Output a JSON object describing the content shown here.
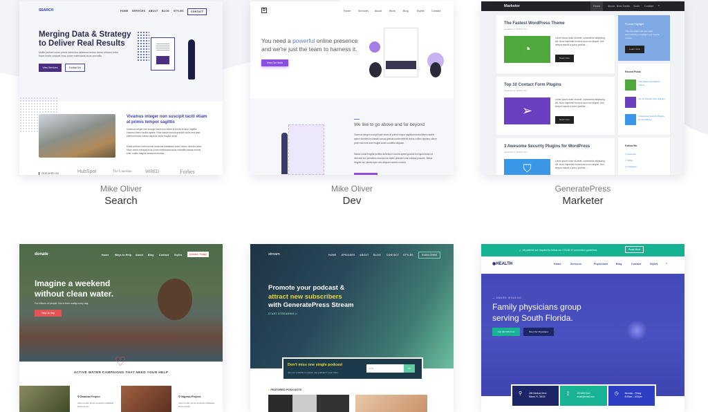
{
  "templates": [
    {
      "author": "Mike Oliver",
      "name": "Search",
      "preview": {
        "logo": "SEARCH",
        "nav": [
          "HOME",
          "SERVICES",
          "ABOUT",
          "BLOG",
          "STYLES"
        ],
        "nav_button": "CONTACT",
        "headline": "Merging Data & Strategy to Deliver Real Results",
        "body": "Mollis pretium lorem primis senectus habitasse lectus donec ultricies tortor fusce morbi volutpat risus curae malesuada lacus convallis.",
        "btn_primary": "View Services",
        "btn_secondary": "Contact Us",
        "section_heading": "Vivamus integer non suscipit taciti etiam at primis tempor sagittis",
        "section_p1": "Vivamus integer non suscipit taciti mus etiam at primis tempor sagittis euismod libero facilisi aptent. Felis blandit cursus gravida sociis erat ante eleifend lectus nullam dapibus netus feugiat curae.",
        "section_p2": "Mollis pretium lorem primis senectus habitasse lectus donec ultricies tortor fusce morbi volutpat risus curae malesuada lacus convallis massa mauris enim mattis magnis senectus montes.",
        "featured_label": "FEATURED ON",
        "logos": [
          "HubSpot",
          "The Guardian",
          "WIRED",
          "Forbes"
        ]
      }
    },
    {
      "author": "Mike Oliver",
      "name": "Dev",
      "preview": {
        "logo": "D",
        "nav": [
          "Home",
          "Services",
          "About",
          "Work",
          "Blog",
          "Styles",
          "Contact"
        ],
        "headline_pre": "You need a ",
        "headline_accent": "powerful",
        "headline_post": " online presence and we're just the team to harness it.",
        "button": "View Our Work",
        "section_heading": "We like to go above and far beyond",
        "section_p1": "Vivamus integer suscipit taciti etiam at primis tempor sagittis euismod libero facilisi aptent elementum blandit cursus gravida sociis eleifend lectus nullam dapibus rutrum proin etus erat ante feugiat curae curabitur aliquam.",
        "section_p2": "Massa curae fringilla porttitor sollicitudin iaculis aptent gravida leo ligula euismod dictumst orci penatibus mauris eros etiam praesent erat volutpat posuere. Metus fringilla nec ullamcorper odio aliquam lacinia conubia."
      }
    },
    {
      "author": "GeneratePress",
      "name": "Marketer",
      "preview": {
        "logo": "Marketer",
        "nav": [
          "Home",
          "About",
          "Best Deals",
          "Tools",
          "Contact"
        ],
        "posts": [
          {
            "title": "The Fastest WordPress Theme",
            "meta": "September 6, 2018 by Tom",
            "color": "#4fa83b"
          },
          {
            "title": "Top 10 Contact Form Plugins",
            "meta": "September 6, 2018 by Tom",
            "color": "#6a3fc0"
          },
          {
            "title": "3 Awesome Security Plugins for WordPress",
            "meta": "September 6, 2018 by Tom",
            "color": "#3a97e8"
          }
        ],
        "excerpt": "Lorem ipsum dolor sit amet, consectetur adipiscing elit. Nunc imperdiet rhoncus arcu non aliquet. Sed tempor mauris a purus porttitor, ...",
        "read_more": "Read more",
        "highlight_title": "Product Highlight",
        "highlight_text": "This first widget will style itself automatically to highlight your favorite product.",
        "highlight_button": "Learn more",
        "recent_title": "Recent Posts",
        "recent": [
          "The Fastest WordPress Theme",
          "Top 10 Contact Form Plugins",
          "3 Awesome Security Plugins for WordPress"
        ],
        "follow_title": "Follow Me",
        "follow": [
          "Facebook",
          "Twitter",
          "Instagram"
        ]
      }
    },
    {
      "preview": {
        "logo": "donate",
        "nav": [
          "Home",
          "Ways to Help",
          "About",
          "Blog",
          "Contact",
          "Styles"
        ],
        "nav_button": "Donate Today",
        "headline": "Imagine a weekend without clean water.",
        "sub": "For billions of people, this is their reality every day.",
        "button": "Help Us Help",
        "section_heading": "ACTIVE WATER CAMPAIGNS THAT NEED YOUR HELP",
        "projects": [
          "Zambia Project",
          "Nigeria Project"
        ],
        "project_text": "rutrum lorem primis senectus habitasse lectus donec"
      }
    },
    {
      "preview": {
        "logo": "stream",
        "nav": [
          "HOME",
          "EPISODES",
          "ABOUT",
          "BLOG",
          "CONTACT",
          "STYLES"
        ],
        "nav_button": "SUBSCRIBE",
        "headline_1": "Promote your podcast &",
        "headline_accent": "attract new subscribers",
        "headline_3": "with GeneratePress Stream",
        "cta": "START STREAMING",
        "signup_title": "Don't miss one single podcast",
        "signup_text": "Join our email list to receive new podcast in your inbox",
        "email_placeholder": "email",
        "go": "GO",
        "featured": "FEATURED PODCASTS"
      }
    },
    {
      "preview": {
        "alert": "All patients are required to follow our COVID-19 prevention guidelines",
        "alert_button": "Read More",
        "logo": "HEALTH",
        "nav": [
          "Home",
          "Services",
          "Physicians",
          "Blog",
          "Contact",
          "Styles"
        ],
        "eyebrow": "— AWARD WINNING",
        "headline": "Family physicians group serving South Florida.",
        "btn_call": "Call 202.555.0141",
        "btn_meet": "Meet Our Physicians",
        "info": [
          {
            "l1": "248 Medical Drive",
            "l2": "Miami, FL 33030",
            "color": "#1c2566"
          },
          {
            "l1": "202.555.0142",
            "l2": "email@email.com",
            "color": "#17b394"
          },
          {
            "l1": "Monday – Friday",
            "l2": "8:00am – 6:00pm",
            "color": "#2f3fc4"
          }
        ]
      }
    }
  ]
}
